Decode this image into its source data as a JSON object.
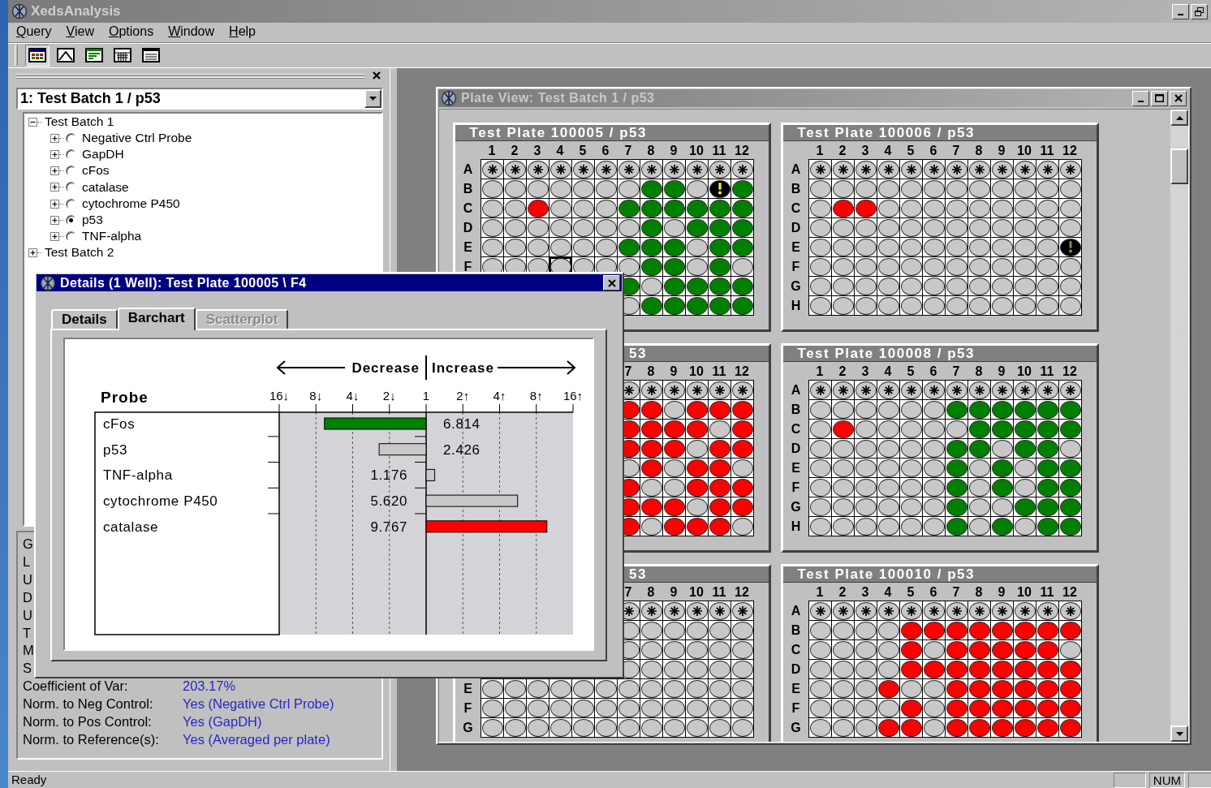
{
  "app": {
    "title": "XedsAnalysis"
  },
  "menu": [
    "Query",
    "View",
    "Options",
    "Window",
    "Help"
  ],
  "toolbar": [
    {
      "kind": "plate",
      "selected": true
    },
    {
      "kind": "curve",
      "selected": false
    },
    {
      "kind": "bars",
      "selected": false
    },
    {
      "kind": "table",
      "selected": false
    },
    {
      "kind": "list",
      "selected": false
    }
  ],
  "left_panel": {
    "selector": "1: Test Batch 1 / p53",
    "tree": [
      {
        "label": "Test Batch 1",
        "expanded": true,
        "children": [
          {
            "label": "Negative Ctrl Probe",
            "expanded": false,
            "selected": false
          },
          {
            "label": "GapDH",
            "expanded": false,
            "selected": false
          },
          {
            "label": "cFos",
            "expanded": false,
            "selected": false
          },
          {
            "label": "catalase",
            "expanded": false,
            "selected": false
          },
          {
            "label": "cytochrome P450",
            "expanded": false,
            "selected": false
          },
          {
            "label": "p53",
            "expanded": false,
            "selected": true
          },
          {
            "label": "TNF-alpha",
            "expanded": false,
            "selected": false
          }
        ]
      },
      {
        "label": "Test Batch 2",
        "expanded": false
      }
    ],
    "properties": [
      {
        "label": "G"
      },
      {
        "label": "L"
      },
      {
        "label": "U"
      },
      {
        "label": "D"
      },
      {
        "label": "U"
      },
      {
        "label": "T"
      },
      {
        "label": "M"
      },
      {
        "label": "S"
      },
      {
        "label": "Coefficient of Var:",
        "value": "203.17%"
      },
      {
        "label": "Norm. to Neg Control:",
        "value": "Yes (Negative Ctrl Probe)"
      },
      {
        "label": "Norm. to Pos Control:",
        "value": "Yes (GapDH)"
      },
      {
        "label": "Norm. to Reference(s):",
        "value": "Yes (Averaged per plate)"
      }
    ]
  },
  "plate_view": {
    "title": "Plate View: Test Batch 1 / p53",
    "plates": [
      {
        "title": "Test Plate 100005 / p53",
        "column_labels": [
          "1",
          "2",
          "3",
          "4",
          "5",
          "6",
          "7",
          "8",
          "9",
          "10",
          "11",
          "12"
        ],
        "rows": [
          {
            "label": "A",
            "wells": [
              {
                "kind": "ctrl"
              },
              {
                "kind": "ctrl"
              },
              {
                "kind": "ctrl"
              },
              {
                "kind": "ctrl"
              },
              {
                "kind": "ctrl"
              },
              {
                "kind": "ctrl"
              },
              {
                "kind": "ctrl"
              },
              {
                "kind": "ctrl"
              },
              {
                "kind": "ctrl"
              },
              {
                "kind": "ctrl"
              },
              {
                "kind": "ctrl"
              },
              {
                "kind": "ctrl"
              }
            ]
          },
          {
            "label": "B",
            "wells": [
              {
                "kind": "none"
              },
              {
                "kind": "none"
              },
              {
                "kind": "none"
              },
              {
                "kind": "none"
              },
              {
                "kind": "none"
              },
              {
                "kind": "none"
              },
              {
                "kind": "none"
              },
              {
                "kind": "down"
              },
              {
                "kind": "down"
              },
              {
                "kind": "none"
              },
              {
                "kind": "flag"
              },
              {
                "kind": "down"
              }
            ]
          },
          {
            "label": "C",
            "wells": [
              {
                "kind": "none"
              },
              {
                "kind": "none"
              },
              {
                "kind": "up"
              },
              {
                "kind": "none"
              },
              {
                "kind": "none"
              },
              {
                "kind": "none"
              },
              {
                "kind": "down"
              },
              {
                "kind": "down"
              },
              {
                "kind": "down"
              },
              {
                "kind": "down"
              },
              {
                "kind": "down"
              },
              {
                "kind": "down"
              }
            ]
          },
          {
            "label": "D",
            "wells": [
              {
                "kind": "none"
              },
              {
                "kind": "none"
              },
              {
                "kind": "none"
              },
              {
                "kind": "none"
              },
              {
                "kind": "none"
              },
              {
                "kind": "none"
              },
              {
                "kind": "none"
              },
              {
                "kind": "down"
              },
              {
                "kind": "none"
              },
              {
                "kind": "down"
              },
              {
                "kind": "down"
              },
              {
                "kind": "down"
              }
            ]
          },
          {
            "label": "E",
            "wells": [
              {
                "kind": "none"
              },
              {
                "kind": "none"
              },
              {
                "kind": "none"
              },
              {
                "kind": "none"
              },
              {
                "kind": "none"
              },
              {
                "kind": "none"
              },
              {
                "kind": "down"
              },
              {
                "kind": "down"
              },
              {
                "kind": "down"
              },
              {
                "kind": "none"
              },
              {
                "kind": "down"
              },
              {
                "kind": "down"
              }
            ]
          },
          {
            "label": "F",
            "wells": [
              {
                "kind": "none"
              },
              {
                "kind": "none"
              },
              {
                "kind": "none"
              },
              {
                "kind": "none",
                "selected": true
              },
              {
                "kind": "none"
              },
              {
                "kind": "none"
              },
              {
                "kind": "none"
              },
              {
                "kind": "down"
              },
              {
                "kind": "down"
              },
              {
                "kind": "none"
              },
              {
                "kind": "down"
              },
              {
                "kind": "none"
              }
            ]
          },
          {
            "wells": [
              {
                "kind": "down"
              },
              {
                "kind": "none"
              },
              {
                "kind": "down"
              },
              {
                "kind": "down"
              },
              {
                "kind": "down"
              },
              {
                "kind": "down"
              }
            ]
          },
          {
            "wells": [
              {
                "kind": "none"
              },
              {
                "kind": "down"
              },
              {
                "kind": "down"
              },
              {
                "kind": "down"
              },
              {
                "kind": "down"
              },
              {
                "kind": "down"
              }
            ]
          }
        ]
      },
      {
        "title": "Test Plate 100006 / p53",
        "column_labels": [
          "1",
          "2",
          "3",
          "4",
          "5",
          "6",
          "7",
          "8",
          "9",
          "10",
          "11",
          "12"
        ],
        "rows": [
          {
            "label": "A",
            "wells": [
              {
                "kind": "ctrl"
              },
              {
                "kind": "ctrl"
              },
              {
                "kind": "ctrl"
              },
              {
                "kind": "ctrl"
              },
              {
                "kind": "ctrl"
              },
              {
                "kind": "ctrl"
              },
              {
                "kind": "ctrl"
              },
              {
                "kind": "ctrl"
              },
              {
                "kind": "ctrl"
              },
              {
                "kind": "ctrl"
              },
              {
                "kind": "ctrl"
              },
              {
                "kind": "ctrl"
              }
            ]
          },
          {
            "label": "B",
            "wells": [
              {
                "kind": "none"
              },
              {
                "kind": "none"
              },
              {
                "kind": "none"
              },
              {
                "kind": "none"
              },
              {
                "kind": "none"
              },
              {
                "kind": "none"
              },
              {
                "kind": "none"
              },
              {
                "kind": "none"
              },
              {
                "kind": "none"
              },
              {
                "kind": "none"
              },
              {
                "kind": "none"
              },
              {
                "kind": "none"
              }
            ]
          },
          {
            "label": "C",
            "wells": [
              {
                "kind": "none"
              },
              {
                "kind": "up"
              },
              {
                "kind": "up"
              },
              {
                "kind": "none"
              },
              {
                "kind": "none"
              },
              {
                "kind": "none"
              },
              {
                "kind": "none"
              },
              {
                "kind": "none"
              },
              {
                "kind": "none"
              },
              {
                "kind": "none"
              },
              {
                "kind": "none"
              },
              {
                "kind": "none"
              }
            ]
          },
          {
            "label": "D",
            "wells": [
              {
                "kind": "none"
              },
              {
                "kind": "none"
              },
              {
                "kind": "none"
              },
              {
                "kind": "none"
              },
              {
                "kind": "none"
              },
              {
                "kind": "none"
              },
              {
                "kind": "none"
              },
              {
                "kind": "none"
              },
              {
                "kind": "none"
              },
              {
                "kind": "none"
              },
              {
                "kind": "none"
              },
              {
                "kind": "none"
              }
            ]
          },
          {
            "label": "E",
            "wells": [
              {
                "kind": "none"
              },
              {
                "kind": "none"
              },
              {
                "kind": "none"
              },
              {
                "kind": "none"
              },
              {
                "kind": "none"
              },
              {
                "kind": "none"
              },
              {
                "kind": "none"
              },
              {
                "kind": "none"
              },
              {
                "kind": "none"
              },
              {
                "kind": "none"
              },
              {
                "kind": "none"
              },
              {
                "kind": "dim"
              }
            ]
          },
          {
            "label": "F",
            "wells": [
              {
                "kind": "none"
              },
              {
                "kind": "none"
              },
              {
                "kind": "none"
              },
              {
                "kind": "none"
              },
              {
                "kind": "none"
              },
              {
                "kind": "none"
              },
              {
                "kind": "none"
              },
              {
                "kind": "none"
              },
              {
                "kind": "none"
              },
              {
                "kind": "none"
              },
              {
                "kind": "none"
              },
              {
                "kind": "none"
              }
            ]
          },
          {
            "label": "G",
            "wells": [
              {
                "kind": "none"
              },
              {
                "kind": "none"
              },
              {
                "kind": "none"
              },
              {
                "kind": "none"
              },
              {
                "kind": "none"
              },
              {
                "kind": "none"
              },
              {
                "kind": "none"
              },
              {
                "kind": "none"
              },
              {
                "kind": "none"
              },
              {
                "kind": "none"
              },
              {
                "kind": "none"
              },
              {
                "kind": "none"
              }
            ]
          },
          {
            "label": "H",
            "wells": [
              {
                "kind": "none"
              },
              {
                "kind": "none"
              },
              {
                "kind": "none"
              },
              {
                "kind": "none"
              },
              {
                "kind": "none"
              },
              {
                "kind": "none"
              },
              {
                "kind": "none"
              },
              {
                "kind": "none"
              },
              {
                "kind": "none"
              },
              {
                "kind": "none"
              },
              {
                "kind": "none"
              },
              {
                "kind": "none"
              }
            ]
          }
        ]
      },
      {
        "title": "53",
        "column_labels": [
          "7",
          "8",
          "9",
          "10",
          "11",
          "12"
        ],
        "rows": [
          {
            "wells": [
              {
                "kind": "ctrl"
              },
              {
                "kind": "ctrl"
              },
              {
                "kind": "ctrl"
              },
              {
                "kind": "ctrl"
              },
              {
                "kind": "ctrl"
              },
              {
                "kind": "ctrl"
              }
            ]
          },
          {
            "wells": [
              {
                "kind": "up"
              },
              {
                "kind": "up"
              },
              {
                "kind": "none"
              },
              {
                "kind": "up"
              },
              {
                "kind": "up"
              },
              {
                "kind": "up"
              }
            ]
          },
          {
            "wells": [
              {
                "kind": "up"
              },
              {
                "kind": "up"
              },
              {
                "kind": "up"
              },
              {
                "kind": "up"
              },
              {
                "kind": "none"
              },
              {
                "kind": "up"
              }
            ]
          },
          {
            "wells": [
              {
                "kind": "up"
              },
              {
                "kind": "up"
              },
              {
                "kind": "up"
              },
              {
                "kind": "none"
              },
              {
                "kind": "up"
              },
              {
                "kind": "up"
              }
            ]
          },
          {
            "wells": [
              {
                "kind": "none"
              },
              {
                "kind": "up"
              },
              {
                "kind": "none"
              },
              {
                "kind": "up"
              },
              {
                "kind": "up"
              },
              {
                "kind": "none"
              }
            ]
          },
          {
            "wells": [
              {
                "kind": "up"
              },
              {
                "kind": "none"
              },
              {
                "kind": "none"
              },
              {
                "kind": "up"
              },
              {
                "kind": "up"
              },
              {
                "kind": "up"
              }
            ]
          },
          {
            "wells": [
              {
                "kind": "up"
              },
              {
                "kind": "up"
              },
              {
                "kind": "up"
              },
              {
                "kind": "none"
              },
              {
                "kind": "up"
              },
              {
                "kind": "up"
              }
            ]
          },
          {
            "wells": [
              {
                "kind": "up"
              },
              {
                "kind": "none"
              },
              {
                "kind": "up"
              },
              {
                "kind": "up"
              },
              {
                "kind": "up"
              },
              {
                "kind": "none"
              }
            ]
          }
        ]
      },
      {
        "title": "Test Plate 100008 / p53",
        "column_labels": [
          "1",
          "2",
          "3",
          "4",
          "5",
          "6",
          "7",
          "8",
          "9",
          "10",
          "11",
          "12"
        ],
        "rows": [
          {
            "label": "A",
            "wells": [
              {
                "kind": "ctrl"
              },
              {
                "kind": "ctrl"
              },
              {
                "kind": "ctrl"
              },
              {
                "kind": "ctrl"
              },
              {
                "kind": "ctrl"
              },
              {
                "kind": "ctrl"
              },
              {
                "kind": "ctrl"
              },
              {
                "kind": "ctrl"
              },
              {
                "kind": "ctrl"
              },
              {
                "kind": "ctrl"
              },
              {
                "kind": "ctrl"
              },
              {
                "kind": "ctrl"
              }
            ]
          },
          {
            "label": "B",
            "wells": [
              {
                "kind": "none"
              },
              {
                "kind": "none"
              },
              {
                "kind": "none"
              },
              {
                "kind": "none"
              },
              {
                "kind": "none"
              },
              {
                "kind": "none"
              },
              {
                "kind": "down"
              },
              {
                "kind": "down"
              },
              {
                "kind": "down"
              },
              {
                "kind": "down"
              },
              {
                "kind": "down"
              },
              {
                "kind": "down"
              }
            ]
          },
          {
            "label": "C",
            "wells": [
              {
                "kind": "none"
              },
              {
                "kind": "up"
              },
              {
                "kind": "none"
              },
              {
                "kind": "none"
              },
              {
                "kind": "none"
              },
              {
                "kind": "none"
              },
              {
                "kind": "none"
              },
              {
                "kind": "down"
              },
              {
                "kind": "down"
              },
              {
                "kind": "down"
              },
              {
                "kind": "down"
              },
              {
                "kind": "down"
              }
            ]
          },
          {
            "label": "D",
            "wells": [
              {
                "kind": "none"
              },
              {
                "kind": "none"
              },
              {
                "kind": "none"
              },
              {
                "kind": "none"
              },
              {
                "kind": "none"
              },
              {
                "kind": "none"
              },
              {
                "kind": "down"
              },
              {
                "kind": "down"
              },
              {
                "kind": "none"
              },
              {
                "kind": "down"
              },
              {
                "kind": "down"
              },
              {
                "kind": "none"
              }
            ]
          },
          {
            "label": "E",
            "wells": [
              {
                "kind": "none"
              },
              {
                "kind": "none"
              },
              {
                "kind": "none"
              },
              {
                "kind": "none"
              },
              {
                "kind": "none"
              },
              {
                "kind": "none"
              },
              {
                "kind": "down"
              },
              {
                "kind": "none"
              },
              {
                "kind": "down"
              },
              {
                "kind": "none"
              },
              {
                "kind": "down"
              },
              {
                "kind": "down"
              }
            ]
          },
          {
            "label": "F",
            "wells": [
              {
                "kind": "none"
              },
              {
                "kind": "none"
              },
              {
                "kind": "none"
              },
              {
                "kind": "none"
              },
              {
                "kind": "none"
              },
              {
                "kind": "none"
              },
              {
                "kind": "down"
              },
              {
                "kind": "none"
              },
              {
                "kind": "down"
              },
              {
                "kind": "none"
              },
              {
                "kind": "down"
              },
              {
                "kind": "down"
              }
            ]
          },
          {
            "label": "G",
            "wells": [
              {
                "kind": "none"
              },
              {
                "kind": "none"
              },
              {
                "kind": "none"
              },
              {
                "kind": "none"
              },
              {
                "kind": "none"
              },
              {
                "kind": "none"
              },
              {
                "kind": "down"
              },
              {
                "kind": "none"
              },
              {
                "kind": "none"
              },
              {
                "kind": "down"
              },
              {
                "kind": "down"
              },
              {
                "kind": "down"
              }
            ]
          },
          {
            "label": "H",
            "wells": [
              {
                "kind": "none"
              },
              {
                "kind": "none"
              },
              {
                "kind": "none"
              },
              {
                "kind": "none"
              },
              {
                "kind": "none"
              },
              {
                "kind": "none"
              },
              {
                "kind": "down"
              },
              {
                "kind": "none"
              },
              {
                "kind": "down"
              },
              {
                "kind": "none"
              },
              {
                "kind": "down"
              },
              {
                "kind": "down"
              }
            ]
          }
        ]
      },
      {
        "title": "53",
        "column_labels": [
          "7",
          "8",
          "9",
          "10",
          "11",
          "12"
        ],
        "rows": [
          {
            "wells": [
              {
                "kind": "ctrl"
              },
              {
                "kind": "ctrl"
              },
              {
                "kind": "ctrl"
              },
              {
                "kind": "ctrl"
              },
              {
                "kind": "ctrl"
              },
              {
                "kind": "ctrl"
              }
            ]
          },
          {
            "wells": [
              {
                "kind": "none"
              },
              {
                "kind": "none"
              },
              {
                "kind": "none"
              },
              {
                "kind": "none"
              },
              {
                "kind": "none"
              },
              {
                "kind": "none"
              }
            ]
          },
          {
            "wells": [
              {
                "kind": "none"
              },
              {
                "kind": "none"
              },
              {
                "kind": "none"
              },
              {
                "kind": "none"
              },
              {
                "kind": "none"
              },
              {
                "kind": "none"
              }
            ]
          },
          {
            "wells": [
              {
                "kind": "none"
              },
              {
                "kind": "none"
              },
              {
                "kind": "none"
              },
              {
                "kind": "none"
              },
              {
                "kind": "none"
              },
              {
                "kind": "none"
              }
            ]
          },
          {
            "label": "E",
            "wells": [
              {
                "kind": "none"
              },
              {
                "kind": "none"
              },
              {
                "kind": "none"
              },
              {
                "kind": "none"
              },
              {
                "kind": "none"
              },
              {
                "kind": "none"
              },
              {
                "kind": "none"
              },
              {
                "kind": "none"
              },
              {
                "kind": "none"
              },
              {
                "kind": "none"
              },
              {
                "kind": "none"
              },
              {
                "kind": "none"
              }
            ]
          },
          {
            "label": "F",
            "wells": [
              {
                "kind": "none"
              },
              {
                "kind": "none"
              },
              {
                "kind": "none"
              },
              {
                "kind": "none"
              },
              {
                "kind": "none"
              },
              {
                "kind": "none"
              },
              {
                "kind": "none"
              },
              {
                "kind": "none"
              },
              {
                "kind": "none"
              },
              {
                "kind": "none"
              },
              {
                "kind": "none"
              },
              {
                "kind": "none"
              }
            ]
          },
          {
            "label": "G",
            "wells": [
              {
                "kind": "none"
              },
              {
                "kind": "none"
              },
              {
                "kind": "none"
              },
              {
                "kind": "none"
              },
              {
                "kind": "none"
              },
              {
                "kind": "none"
              },
              {
                "kind": "none"
              },
              {
                "kind": "none"
              },
              {
                "kind": "none"
              },
              {
                "kind": "none"
              },
              {
                "kind": "none"
              },
              {
                "kind": "none"
              }
            ]
          }
        ]
      },
      {
        "title": "Test Plate 100010 / p53",
        "column_labels": [
          "1",
          "2",
          "3",
          "4",
          "5",
          "6",
          "7",
          "8",
          "9",
          "10",
          "11",
          "12"
        ],
        "rows": [
          {
            "label": "A",
            "wells": [
              {
                "kind": "ctrl"
              },
              {
                "kind": "ctrl"
              },
              {
                "kind": "ctrl"
              },
              {
                "kind": "ctrl"
              },
              {
                "kind": "ctrl"
              },
              {
                "kind": "ctrl"
              },
              {
                "kind": "ctrl"
              },
              {
                "kind": "ctrl"
              },
              {
                "kind": "ctrl"
              },
              {
                "kind": "ctrl"
              },
              {
                "kind": "ctrl"
              },
              {
                "kind": "ctrl"
              }
            ]
          },
          {
            "label": "B",
            "wells": [
              {
                "kind": "none"
              },
              {
                "kind": "none"
              },
              {
                "kind": "none"
              },
              {
                "kind": "none"
              },
              {
                "kind": "up"
              },
              {
                "kind": "up"
              },
              {
                "kind": "up"
              },
              {
                "kind": "up"
              },
              {
                "kind": "up"
              },
              {
                "kind": "up"
              },
              {
                "kind": "up"
              },
              {
                "kind": "up"
              }
            ]
          },
          {
            "label": "C",
            "wells": [
              {
                "kind": "none"
              },
              {
                "kind": "none"
              },
              {
                "kind": "none"
              },
              {
                "kind": "none"
              },
              {
                "kind": "up"
              },
              {
                "kind": "none"
              },
              {
                "kind": "up"
              },
              {
                "kind": "up"
              },
              {
                "kind": "up"
              },
              {
                "kind": "up"
              },
              {
                "kind": "up"
              },
              {
                "kind": "none"
              }
            ]
          },
          {
            "label": "D",
            "wells": [
              {
                "kind": "none"
              },
              {
                "kind": "none"
              },
              {
                "kind": "none"
              },
              {
                "kind": "none"
              },
              {
                "kind": "up"
              },
              {
                "kind": "up"
              },
              {
                "kind": "up"
              },
              {
                "kind": "up"
              },
              {
                "kind": "up"
              },
              {
                "kind": "up"
              },
              {
                "kind": "up"
              },
              {
                "kind": "up"
              }
            ]
          },
          {
            "label": "E",
            "wells": [
              {
                "kind": "none"
              },
              {
                "kind": "none"
              },
              {
                "kind": "none"
              },
              {
                "kind": "up"
              },
              {
                "kind": "none"
              },
              {
                "kind": "none"
              },
              {
                "kind": "up"
              },
              {
                "kind": "up"
              },
              {
                "kind": "up"
              },
              {
                "kind": "up"
              },
              {
                "kind": "up"
              },
              {
                "kind": "up"
              }
            ]
          },
          {
            "label": "F",
            "wells": [
              {
                "kind": "none"
              },
              {
                "kind": "none"
              },
              {
                "kind": "none"
              },
              {
                "kind": "none"
              },
              {
                "kind": "up"
              },
              {
                "kind": "none"
              },
              {
                "kind": "up"
              },
              {
                "kind": "up"
              },
              {
                "kind": "up"
              },
              {
                "kind": "up"
              },
              {
                "kind": "up"
              },
              {
                "kind": "up"
              }
            ]
          },
          {
            "label": "G",
            "wells": [
              {
                "kind": "none"
              },
              {
                "kind": "none"
              },
              {
                "kind": "none"
              },
              {
                "kind": "up"
              },
              {
                "kind": "up"
              },
              {
                "kind": "none"
              },
              {
                "kind": "up"
              },
              {
                "kind": "up"
              },
              {
                "kind": "up"
              },
              {
                "kind": "up"
              },
              {
                "kind": "up"
              },
              {
                "kind": "up"
              }
            ]
          }
        ]
      }
    ]
  },
  "dialog": {
    "title": "Details (1 Well): Test Plate 100005 \\ F4",
    "tabs": [
      {
        "label": "Details",
        "selected": false,
        "disabled": false
      },
      {
        "label": "Barchart",
        "selected": true,
        "disabled": false
      },
      {
        "label": "Scatterplot",
        "selected": false,
        "disabled": true
      }
    ],
    "probe_header": "Probe",
    "scale_labels": [
      "16↓",
      "8↓",
      "4↓",
      "2↓",
      "1",
      "2↑",
      "4↑",
      "8↑",
      "16↑"
    ],
    "decrease_label": "Decrease",
    "increase_label": "Increase",
    "probes": [
      {
        "name": "cFos",
        "fold": "6.814",
        "kind": "decrease",
        "color": "#008000"
      },
      {
        "name": "p53",
        "fold": "2.426",
        "kind": "decrease",
        "color": "#c8c8c8"
      },
      {
        "name": "TNF-alpha",
        "fold": "1.176",
        "kind": "increase",
        "color": "#c8c8c8"
      },
      {
        "name": "cytochrome P450",
        "fold": "5.620",
        "kind": "increase",
        "color": "#c8c8c8"
      },
      {
        "name": "catalase",
        "fold": "9.767",
        "kind": "increase",
        "color": "#ff0000"
      }
    ]
  },
  "status_bar": {
    "text": "Ready",
    "indicator": "NUM"
  }
}
